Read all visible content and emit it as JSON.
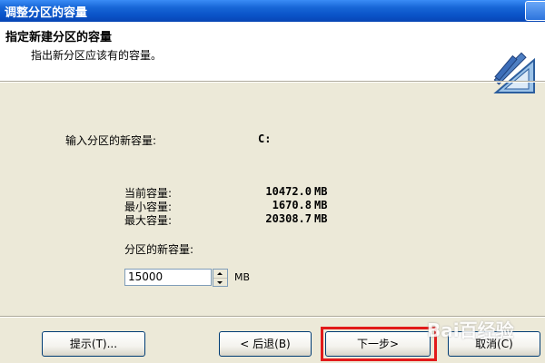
{
  "window": {
    "title": "调整分区的容量"
  },
  "header": {
    "title": "指定新建分区的容量",
    "subtitle": "指出新分区应该有的容量。",
    "icon": "wizard-ruler-icon"
  },
  "form": {
    "input_label": "输入分区的新容量:",
    "partition": "C:",
    "current_label": "当前容量:",
    "current_value": "10472.0",
    "min_label": "最小容量:",
    "min_value": "1670.8",
    "max_label": "最大容量:",
    "max_value": "20308.7",
    "unit_mb": "MB",
    "new_size_label": "分区的新容量:",
    "new_size_value": "15000",
    "new_size_unit": "MB"
  },
  "buttons": {
    "hint": "提示(T)...",
    "back": "< 后退(B)",
    "next": "下一步>",
    "cancel": "取消(C)"
  },
  "watermark": "Bai百经验",
  "colors": {
    "titlebar": "#0A53C8",
    "dialog_bg": "#ECE9D8",
    "highlight": "#E21A1A"
  }
}
